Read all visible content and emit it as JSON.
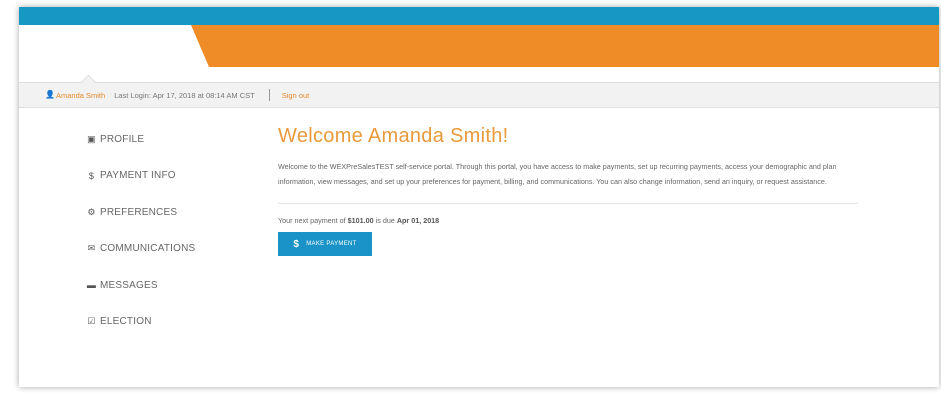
{
  "header": {
    "user_icon": "user-icon",
    "user_name": "Amanda Smith",
    "last_login": "Last Login: Apr 17, 2018 at 08:14 AM CST",
    "sign_out": "Sign out"
  },
  "sidebar": {
    "items": [
      {
        "label": "PROFILE",
        "icon": "id-card-icon",
        "glyph": "▣"
      },
      {
        "label": "PAYMENT INFO",
        "icon": "dollar-icon",
        "glyph": "$"
      },
      {
        "label": "PREFERENCES",
        "icon": "gears-icon",
        "glyph": "⚙"
      },
      {
        "label": "COMMUNICATIONS",
        "icon": "envelope-icon",
        "glyph": "✉"
      },
      {
        "label": "MESSAGES",
        "icon": "chat-bubble-icon",
        "glyph": "▬"
      },
      {
        "label": "ELECTION",
        "icon": "checkbox-icon",
        "glyph": "☑"
      }
    ]
  },
  "main": {
    "title": "Welcome Amanda Smith!",
    "intro": "Welcome to the WEXPreSalesTEST self-service portal. Through this portal, you have access to make payments, set up recurring payments, access your demographic and plan information, view messages, and set up your preferences for payment, billing, and communications. You can also change information, send an inquiry, or request assistance.",
    "payment_prefix": "Your next payment of ",
    "payment_amount": "$101.00",
    "payment_middle": " is due ",
    "payment_due": "Apr 01, 2018",
    "button_label": "MAKE PAYMENT",
    "button_icon": "$"
  },
  "colors": {
    "top_bar": "#1797c4",
    "banner": "#f08c28",
    "accent_text": "#e89a3b",
    "button": "#1a94c8"
  }
}
